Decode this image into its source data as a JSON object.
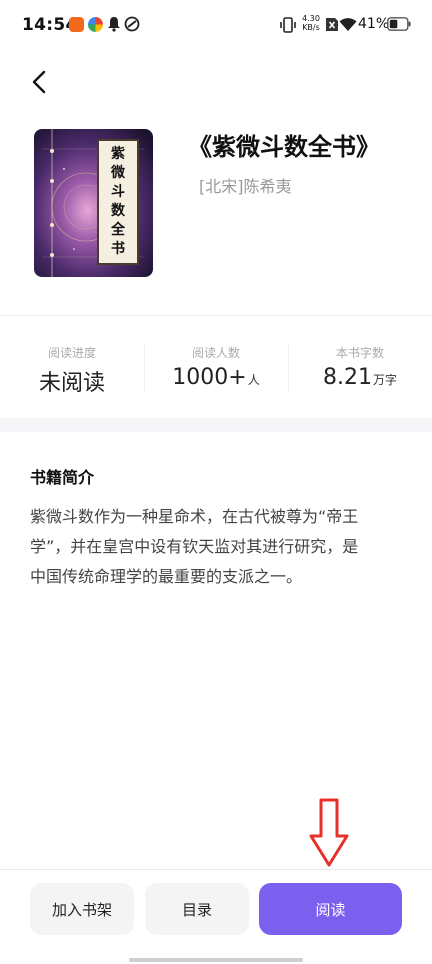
{
  "status_bar": {
    "time": "14:54",
    "network_speed_value": "4.30",
    "network_speed_unit": "KB/s",
    "battery": "41%"
  },
  "book": {
    "title": "《紫微斗数全书》",
    "author": "[北宋]陈希夷",
    "cover_text": [
      "紫",
      "微",
      "斗",
      "数",
      "全",
      "书"
    ]
  },
  "stats": [
    {
      "label": "阅读进度",
      "value": "未阅读",
      "unit": ""
    },
    {
      "label": "阅读人数",
      "value": "1000+",
      "unit": "人"
    },
    {
      "label": "本书字数",
      "value": "8.21",
      "unit": "万字"
    }
  ],
  "intro": {
    "heading": "书籍简介",
    "lines": [
      "紫微斗数作为一种星命术，在古代被尊为“帝王",
      "学”，并在皇宫中设有钦天监对其进行研究，是",
      "中国传统命理学的最重要的支派之一。"
    ]
  },
  "actions": {
    "add_to_shelf": "加入书架",
    "catalog": "目录",
    "read": "阅读"
  },
  "colors": {
    "accent": "#7b60f0",
    "annotation_arrow": "#e8302a"
  }
}
